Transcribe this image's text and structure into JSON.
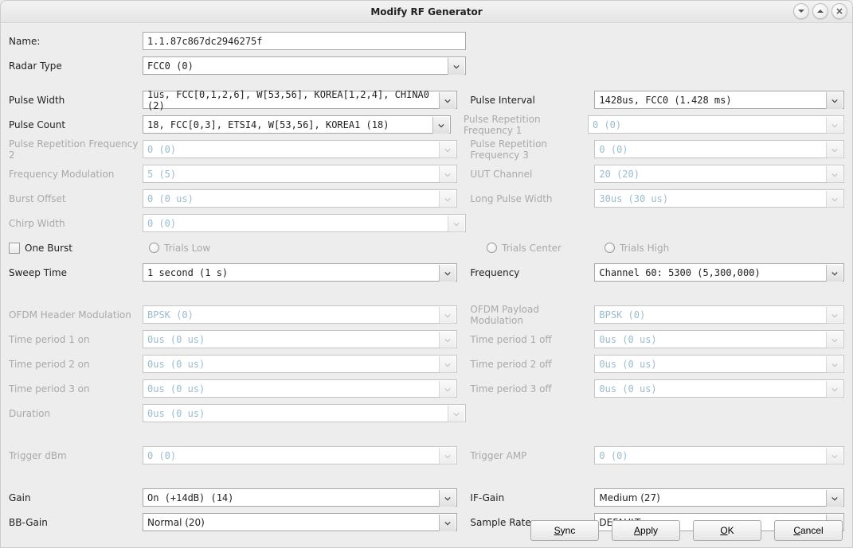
{
  "window": {
    "title": "Modify RF Generator"
  },
  "labels": {
    "name": "Name:",
    "radarType": "Radar Type",
    "pulseWidth": "Pulse Width",
    "pulseInterval": "Pulse Interval",
    "pulseCount": "Pulse Count",
    "prf1": "Pulse Repetition Frequency 1",
    "prf2": "Pulse Repetition Frequency 2",
    "prf3": "Pulse Repetition Frequency 3",
    "freqMod": "Frequency Modulation",
    "uutChannel": "UUT Channel",
    "burstOffset": "Burst Offset",
    "longPulseWidth": "Long Pulse Width",
    "chirpWidth": "Chirp Width",
    "oneBurst": "One Burst",
    "trialsLow": "Trials Low",
    "trialsCenter": "Trials Center",
    "trialsHigh": "Trials High",
    "sweepTime": "Sweep Time",
    "frequency": "Frequency",
    "ofdmHeaderMod": "OFDM Header Modulation",
    "ofdmPayloadMod": "OFDM Payload Modulation",
    "tp1on": "Time period 1 on",
    "tp1off": "Time period 1 off",
    "tp2on": "Time period 2 on",
    "tp2off": "Time period 2 off",
    "tp3on": "Time period 3 on",
    "tp3off": "Time period 3 off",
    "duration": "Duration",
    "triggerDbm": "Trigger dBm",
    "triggerAmp": "Trigger AMP",
    "gain": "Gain",
    "ifGain": "IF-Gain",
    "bbGain": "BB-Gain",
    "sampleRate": "Sample Rate"
  },
  "values": {
    "name": "1.1.87c867dc2946275f",
    "radarType": "FCC0 (0)",
    "pulseWidth": "1us, FCC[0,1,2,6], W[53,56], KOREA[1,2,4], CHINA0 (2)",
    "pulseInterval": "1428us, FCC0 (1.428 ms)",
    "pulseCount": "18, FCC[0,3], ETSI4, W[53,56], KOREA1 (18)",
    "prf1": "0 (0)",
    "prf2": "0 (0)",
    "prf3": "0 (0)",
    "freqMod": "5 (5)",
    "uutChannel": "20 (20)",
    "burstOffset": "0 (0 us)",
    "longPulseWidth": "30us (30 us)",
    "chirpWidth": "0 (0)",
    "sweepTime": "1 second (1 s)",
    "frequency": "Channel 60: 5300 (5,300,000)",
    "ofdmHeaderMod": "BPSK (0)",
    "ofdmPayloadMod": "BPSK (0)",
    "tp1on": "0us (0 us)",
    "tp1off": "0us (0 us)",
    "tp2on": "0us (0 us)",
    "tp2off": "0us (0 us)",
    "tp3on": "0us (0 us)",
    "tp3off": "0us (0 us)",
    "duration": "0us (0 us)",
    "triggerDbm": "0 (0)",
    "triggerAmp": "0 (0)",
    "gain": "On (+14dB) (14)",
    "ifGain": "Medium (27)",
    "bbGain": "Normal (20)",
    "sampleRate": "DEFAULT"
  },
  "buttons": {
    "sync": "Sync",
    "apply": "Apply",
    "ok": "OK",
    "cancel": "Cancel"
  }
}
